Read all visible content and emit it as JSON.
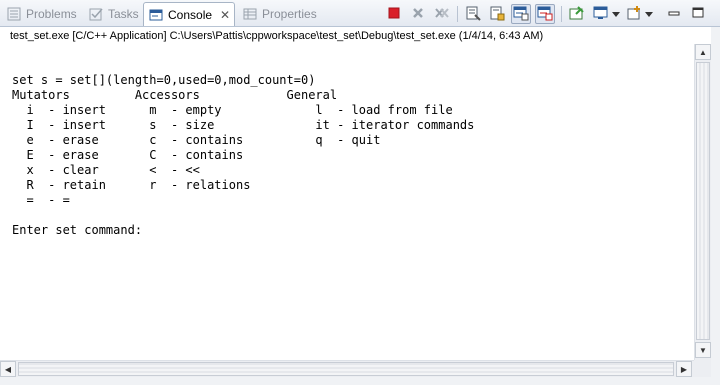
{
  "tabs": [
    {
      "label": "Problems",
      "icon": "problems-icon"
    },
    {
      "label": "Tasks",
      "icon": "tasks-icon"
    },
    {
      "label": "Console",
      "icon": "console-icon",
      "active": true
    },
    {
      "label": "Properties",
      "icon": "properties-icon"
    }
  ],
  "toolbar": {
    "icons": [
      "terminate-icon",
      "remove-launch-icon",
      "remove-all-terminated-icon",
      "clear-console-icon",
      "scroll-lock-icon",
      "show-on-stdout-icon",
      "show-on-stderr-icon",
      "pin-console-icon",
      "display-selected-console-icon",
      "open-console-icon",
      "minimize-icon",
      "maximize-icon"
    ]
  },
  "process_line": "test_set.exe [C/C++ Application] C:\\Users\\Pattis\\cppworkspace\\test_set\\Debug\\test_set.exe (1/4/14, 6:43 AM)",
  "console_text": "set s = set[](length=0,used=0,mod_count=0)\nMutators         Accessors            General\n  i  - insert      m  - empty             l  - load from file\n  I  - insert      s  - size              it - iterator commands\n  e  - erase       c  - contains          q  - quit\n  E  - erase       C  - contains\n  x  - clear       <  - <<\n  R  - retain      r  - relations\n  =  - =\n\nEnter set command:",
  "colors": {
    "terminate": "#d9202a",
    "accent": "#1f5fa8"
  }
}
